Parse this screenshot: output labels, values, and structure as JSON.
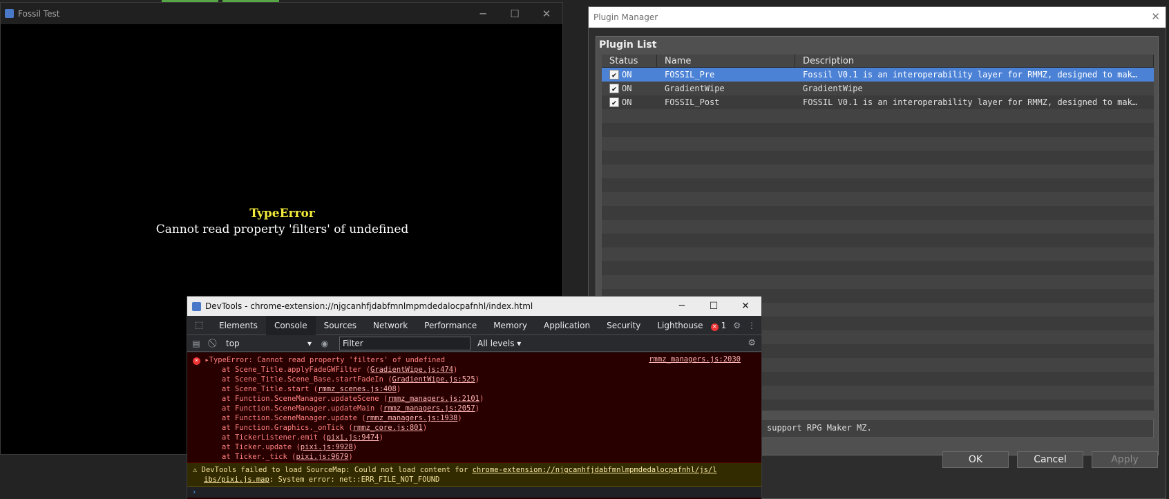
{
  "game": {
    "title": "Fossil Test",
    "error_title": "TypeError",
    "error_message": "Cannot read property 'filters' of undefined"
  },
  "plugin_manager": {
    "title": "Plugin Manager",
    "list_label": "Plugin List",
    "columns": [
      "Status",
      "Name",
      "Description"
    ],
    "rows": [
      {
        "status": "ON",
        "name": "FOSSIL_Pre",
        "description": "Fossil V0.1 is an interoperability layer for RMMZ, designed to make…"
      },
      {
        "status": "ON",
        "name": "GradientWipe",
        "description": "GradientWipe"
      },
      {
        "status": "ON",
        "name": "FOSSIL_Post",
        "description": "FOSSIL V0.1 is an interoperability layer for RMMZ, designed to make…"
      }
    ],
    "description_text": "support RPG Maker MZ.",
    "ok": "OK",
    "cancel": "Cancel",
    "apply": "Apply"
  },
  "devtools": {
    "title": "DevTools - chrome-extension://njgcanhfjdabfmnlmpmdedalocpafnhl/index.html",
    "tabs": [
      "Elements",
      "Console",
      "Sources",
      "Network",
      "Performance",
      "Memory",
      "Application",
      "Security",
      "Lighthouse"
    ],
    "error_count": "1",
    "context": "top",
    "filter_placeholder": "Filter",
    "levels": "All levels",
    "error_source": "rmmz_managers.js:2030",
    "error_first": "TypeError: Cannot read property 'filters' of undefined",
    "stack": [
      {
        "text": "at Scene_Title.applyFadeGWFilter (",
        "link": "GradientWipe.js:474"
      },
      {
        "text": "at Scene_Title.Scene_Base.startFadeIn (",
        "link": "GradientWipe.js:525"
      },
      {
        "text": "at Scene_Title.start (",
        "link": "rmmz_scenes.js:408"
      },
      {
        "text": "at Function.SceneManager.updateScene (",
        "link": "rmmz_managers.js:2101"
      },
      {
        "text": "at Function.SceneManager.updateMain (",
        "link": "rmmz_managers.js:2057"
      },
      {
        "text": "at Function.SceneManager.update (",
        "link": "rmmz_managers.js:1938"
      },
      {
        "text": "at Function.Graphics._onTick (",
        "link": "rmmz_core.js:801"
      },
      {
        "text": "at TickerListener.emit (",
        "link": "pixi.js:9474"
      },
      {
        "text": "at Ticker.update (",
        "link": "pixi.js:9928"
      },
      {
        "text": "at Ticker._tick (",
        "link": "pixi.js:9679"
      }
    ],
    "warning_line1_prefix": "DevTools failed to load SourceMap: Could not load content for ",
    "warning_link_a": "chrome-extension://njgcanhfjdabfmnlmpmdedalocpafnhl/js/l",
    "warning_link_b": "ibs/pixi.js.map",
    "warning_line2_suffix": ": System error: net::ERR_FILE_NOT_FOUND",
    "prompt": "›"
  }
}
